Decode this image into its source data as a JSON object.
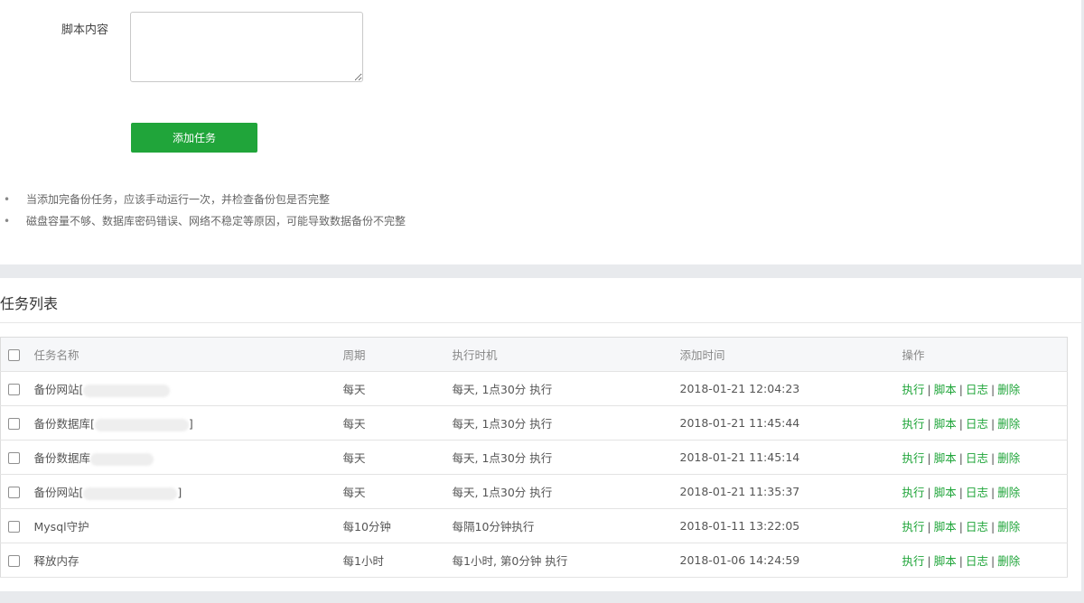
{
  "form": {
    "script_label": "脚本内容",
    "script_value": "",
    "add_button_label": "添加任务"
  },
  "notes": [
    "当添加完备份任务，应该手动运行一次，并检查备份包是否完整",
    "磁盘容量不够、数据库密码错误、网络不稳定等原因，可能导致数据备份不完整"
  ],
  "task_list": {
    "title": "任务列表",
    "columns": {
      "name": "任务名称",
      "cycle": "周期",
      "exec_time": "执行时机",
      "added_time": "添加时间",
      "actions": "操作"
    },
    "action_labels": {
      "run": "执行",
      "script": "脚本",
      "log": "日志",
      "delete": "删除",
      "separator": "|"
    },
    "rows": [
      {
        "name": "备份网站[",
        "name_suffix": "",
        "cycle": "每天",
        "exec_time": "每天, 1点30分 执行",
        "added_time": "2018-01-21 12:04:23"
      },
      {
        "name": "备份数据库[",
        "name_suffix": "]",
        "cycle": "每天",
        "exec_time": "每天, 1点30分 执行",
        "added_time": "2018-01-21 11:45:44"
      },
      {
        "name": "备份数据库",
        "name_suffix": "",
        "cycle": "每天",
        "exec_time": "每天, 1点30分 执行",
        "added_time": "2018-01-21 11:45:14"
      },
      {
        "name": "备份网站[",
        "name_suffix": "]",
        "cycle": "每天",
        "exec_time": "每天, 1点30分 执行",
        "added_time": "2018-01-21 11:35:37"
      },
      {
        "name": "Mysql守护",
        "name_suffix": "",
        "cycle": "每10分钟",
        "exec_time": "每隔10分钟执行",
        "added_time": "2018-01-11 13:22:05"
      },
      {
        "name": "释放内存",
        "name_suffix": "",
        "cycle": "每1小时",
        "exec_time": "每1小时, 第0分钟 执行",
        "added_time": "2018-01-06 14:24:59"
      }
    ]
  }
}
